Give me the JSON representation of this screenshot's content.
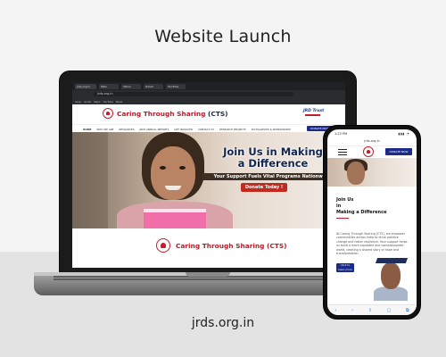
{
  "page": {
    "headline": "Website Launch",
    "footer_url": "jrds.org.in"
  },
  "laptop": {
    "browser": {
      "tabs": [
        "jrds.org.in",
        "Tabs",
        "Yahoo",
        "Gmail",
        "YouTube"
      ],
      "address": "jrds.org.in",
      "bookmarks": [
        "Apps",
        "Gmail",
        "Maps",
        "YouTube",
        "News"
      ]
    },
    "site": {
      "brand_name": "Caring Through Sharing",
      "brand_suffix": "(CTS)",
      "partner_logo_text": "JRD Trust",
      "nav": [
        "HOME",
        "WHO WE ARE",
        "RESOURCES",
        "JRDS ANNUAL REPORTS",
        "GET INVOLVED",
        "CONTACT US",
        "RESEARCH PROJECTS",
        "SCHOLARSHIP & SPONSORSHIP"
      ],
      "donate_label": "DONATE NOW",
      "hero": {
        "title_line1": "Join Us in Making",
        "title_line2": "a Difference",
        "tagline": "Your Support Fuels Vital Programs Nationwide",
        "cta_label": "Donate Today !"
      },
      "footer_brand": "Caring Through Sharing (CTS)"
    }
  },
  "phone": {
    "status": {
      "time": "1:23 PM",
      "signal": "▮▮▮ ◔"
    },
    "address": "jrds.org.in",
    "donate_label": "DONATE NOW",
    "heading_line1": "Join Us",
    "heading_line2": "in",
    "heading_line3": "Making a Difference",
    "body": "At Caring Through Sharing (CTS), we empower communities across India to drive positive change and foster resilience. Your support helps us build a more equitable and compassionate world, creating a shared story of hope and transformation.",
    "learn_label_1": "Click to",
    "learn_label_2": "learn more",
    "toolbar": [
      "‹",
      "›",
      "⇪",
      "▢",
      "⧉"
    ]
  },
  "colors": {
    "brand_red": "#b71c2a",
    "brand_navy": "#1c2a8a",
    "cta_red": "#c12b1e"
  }
}
